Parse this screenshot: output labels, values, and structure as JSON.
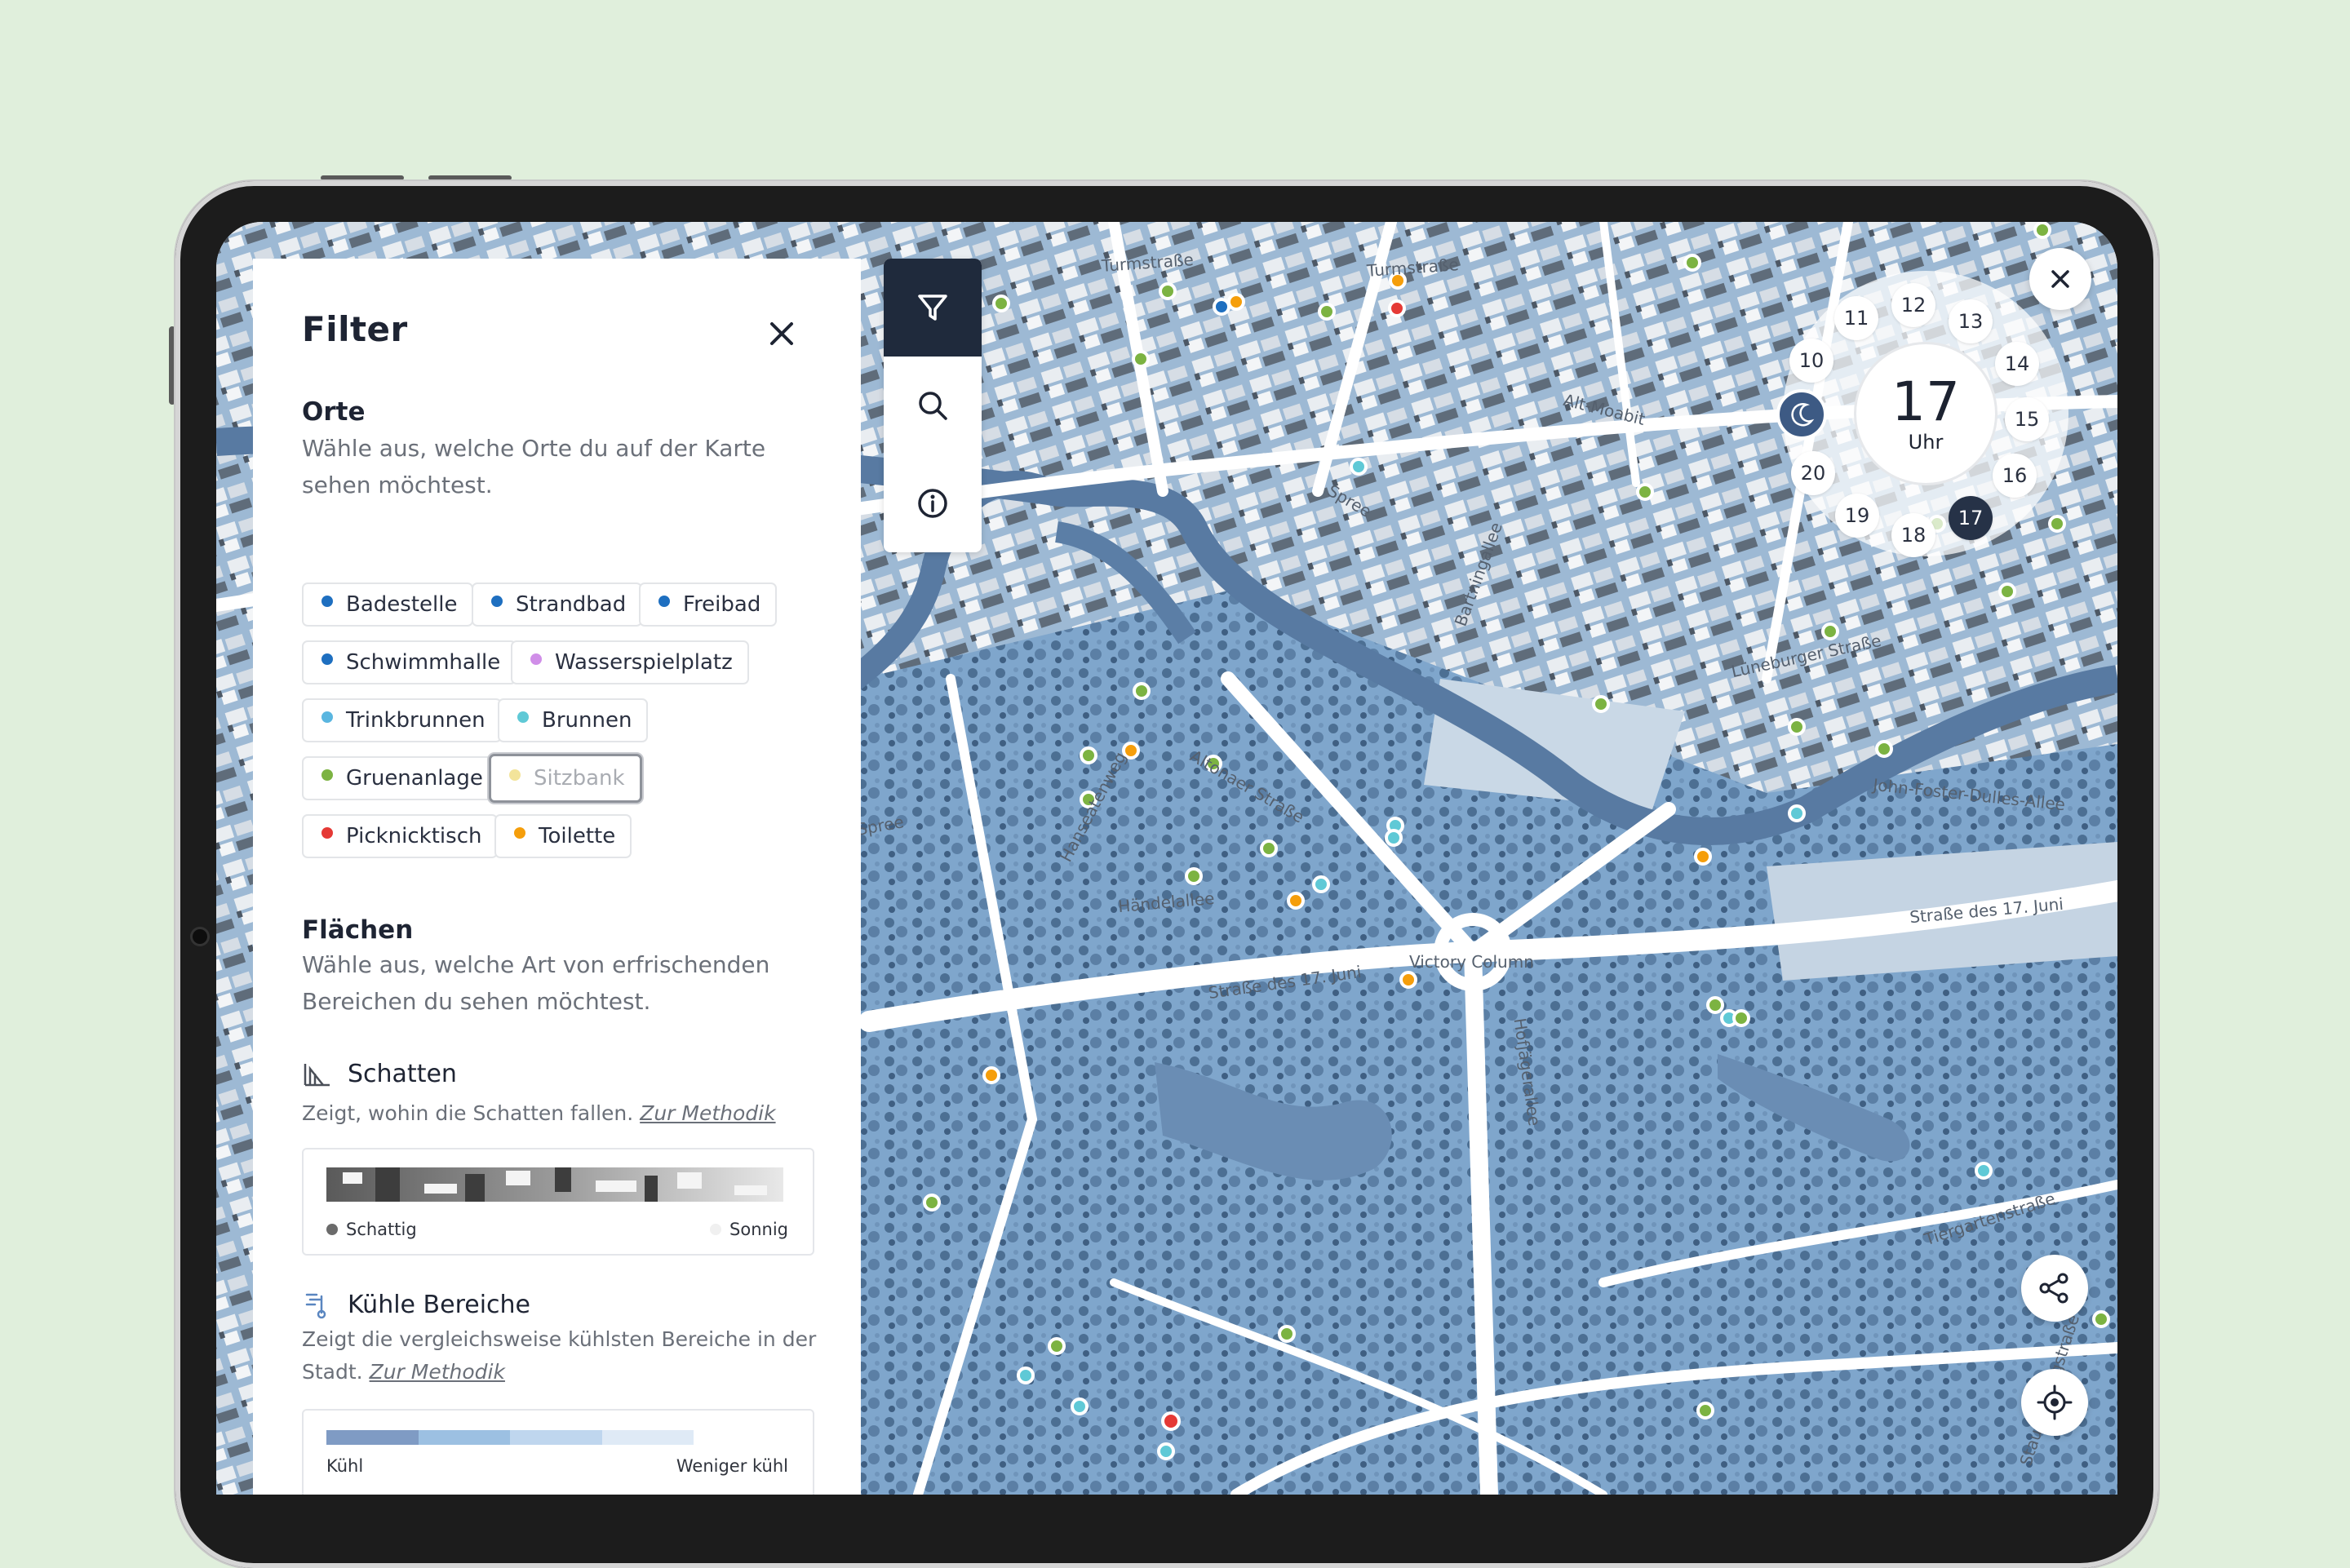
{
  "filter_panel": {
    "title": "Filter",
    "places": {
      "title": "Orte",
      "description": "Wähle aus, welche Orte du auf der Karte sehen möchtest.",
      "chips": [
        {
          "label": "Badestelle",
          "color": "#1e6fc0",
          "selected": false
        },
        {
          "label": "Strandbad",
          "color": "#1e6fc0",
          "selected": false
        },
        {
          "label": "Freibad",
          "color": "#1e6fc0",
          "selected": false
        },
        {
          "label": "Schwimmhalle",
          "color": "#1e6fc0",
          "selected": false
        },
        {
          "label": "Wasserspielplatz",
          "color": "#d08ee8",
          "selected": false
        },
        {
          "label": "Trinkbrunnen",
          "color": "#5ab6e0",
          "selected": false
        },
        {
          "label": "Brunnen",
          "color": "#5fc9d6",
          "selected": false
        },
        {
          "label": "Gruenanlage",
          "color": "#7cb342",
          "selected": false
        },
        {
          "label": "Sitzbank",
          "color": "#f3e49a",
          "selected": true
        },
        {
          "label": "Picknicktisch",
          "color": "#e53935",
          "selected": false
        },
        {
          "label": "Toilette",
          "color": "#f59e0b",
          "selected": false
        }
      ]
    },
    "areas": {
      "title": "Flächen",
      "description": "Wähle aus, welche Art von erfrischenden Bereichen du sehen möchtest.",
      "shadow": {
        "title": "Schatten",
        "description": "Zeigt, wohin die Schatten fallen.",
        "link": "Zur Methodik",
        "legend_left": "Schattig",
        "legend_right": "Sonnig"
      },
      "cool": {
        "title": "Kühle Bereiche",
        "description": "Zeigt die vergleichsweise kühlsten Bereiche in der Stadt.",
        "link": "Zur Methodik",
        "legend_left": "Kühl",
        "legend_right": "Weniger kühl"
      }
    }
  },
  "toolbar": {
    "items": [
      {
        "name": "filter",
        "icon": "filter-icon",
        "active": true
      },
      {
        "name": "search",
        "icon": "search-icon",
        "active": false
      },
      {
        "name": "info",
        "icon": "info-icon",
        "active": false
      }
    ]
  },
  "time_dial": {
    "selected_hour": "17",
    "unit": "Uhr",
    "hours": [
      "10",
      "11",
      "12",
      "13",
      "14",
      "15",
      "16",
      "17",
      "18",
      "19",
      "20"
    ]
  },
  "map": {
    "labels": [
      "Turmstraße",
      "Turmstraße",
      "Alt-Moabit",
      "Spree",
      "Bartningallee",
      "Altonaer Straße",
      "Hanseatenweg",
      "Händelallee",
      "Straße des 17. Juni",
      "Straße des 17. Juni",
      "Victory Column",
      "Hofjägerallee",
      "John-Foster-Dulles-Allee",
      "Lüneburger Straße",
      "Tiergartenstraße",
      "Stauffenbergstraße",
      "Spree"
    ],
    "colors": {
      "shade": "#98b9d8",
      "water": "#5d7ea6",
      "roads": "#ffffff"
    }
  }
}
